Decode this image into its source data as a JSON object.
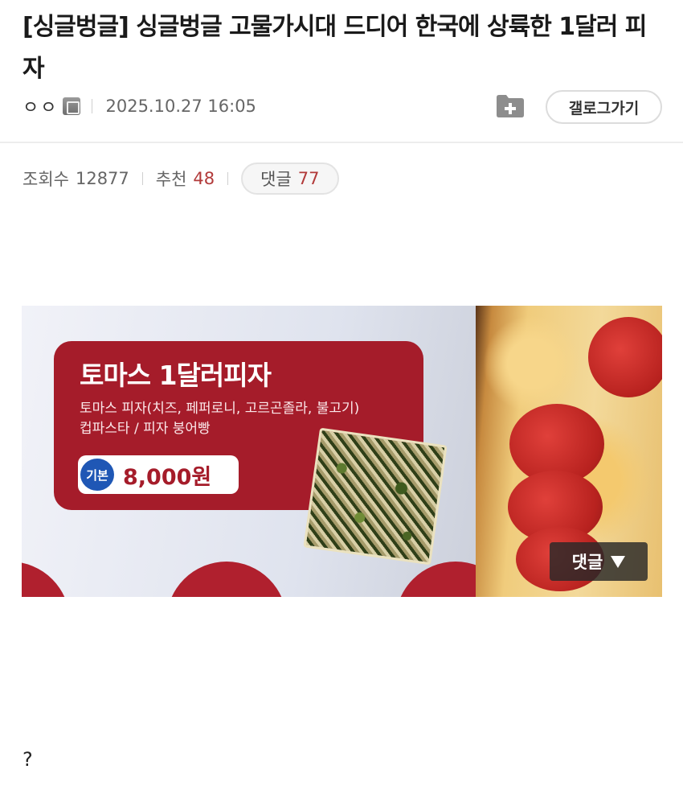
{
  "post": {
    "title": "[싱글벙글] 싱글벙글 고물가시대 드디어 한국에 상륙한 1달러 피자",
    "author": "ㅇㅇ",
    "date": "2025.10.27 16:05",
    "gallery_button": "갤로그가기"
  },
  "stats": {
    "views_label": "조회수",
    "views": "12877",
    "recommend_label": "추천",
    "recommend": "48",
    "comments_label": "댓글",
    "comments": "77"
  },
  "image": {
    "promo_title": "토마스 1달러피자",
    "promo_desc_line1": "토마스 피자(치즈, 페퍼로니, 고르곤졸라, 불고기)",
    "promo_desc_line2": "컵파스타 / 피자 붕어빵",
    "price_badge": "기본",
    "price": "8,000원",
    "comment_button": "댓글"
  },
  "body": {
    "text": "?"
  },
  "colors": {
    "accent_red": "#b23a3a",
    "panel_red": "#a51c2a",
    "badge_blue": "#1f57b5"
  },
  "icons": [
    "level-icon",
    "folder-add-icon",
    "triangle-down-icon"
  ]
}
